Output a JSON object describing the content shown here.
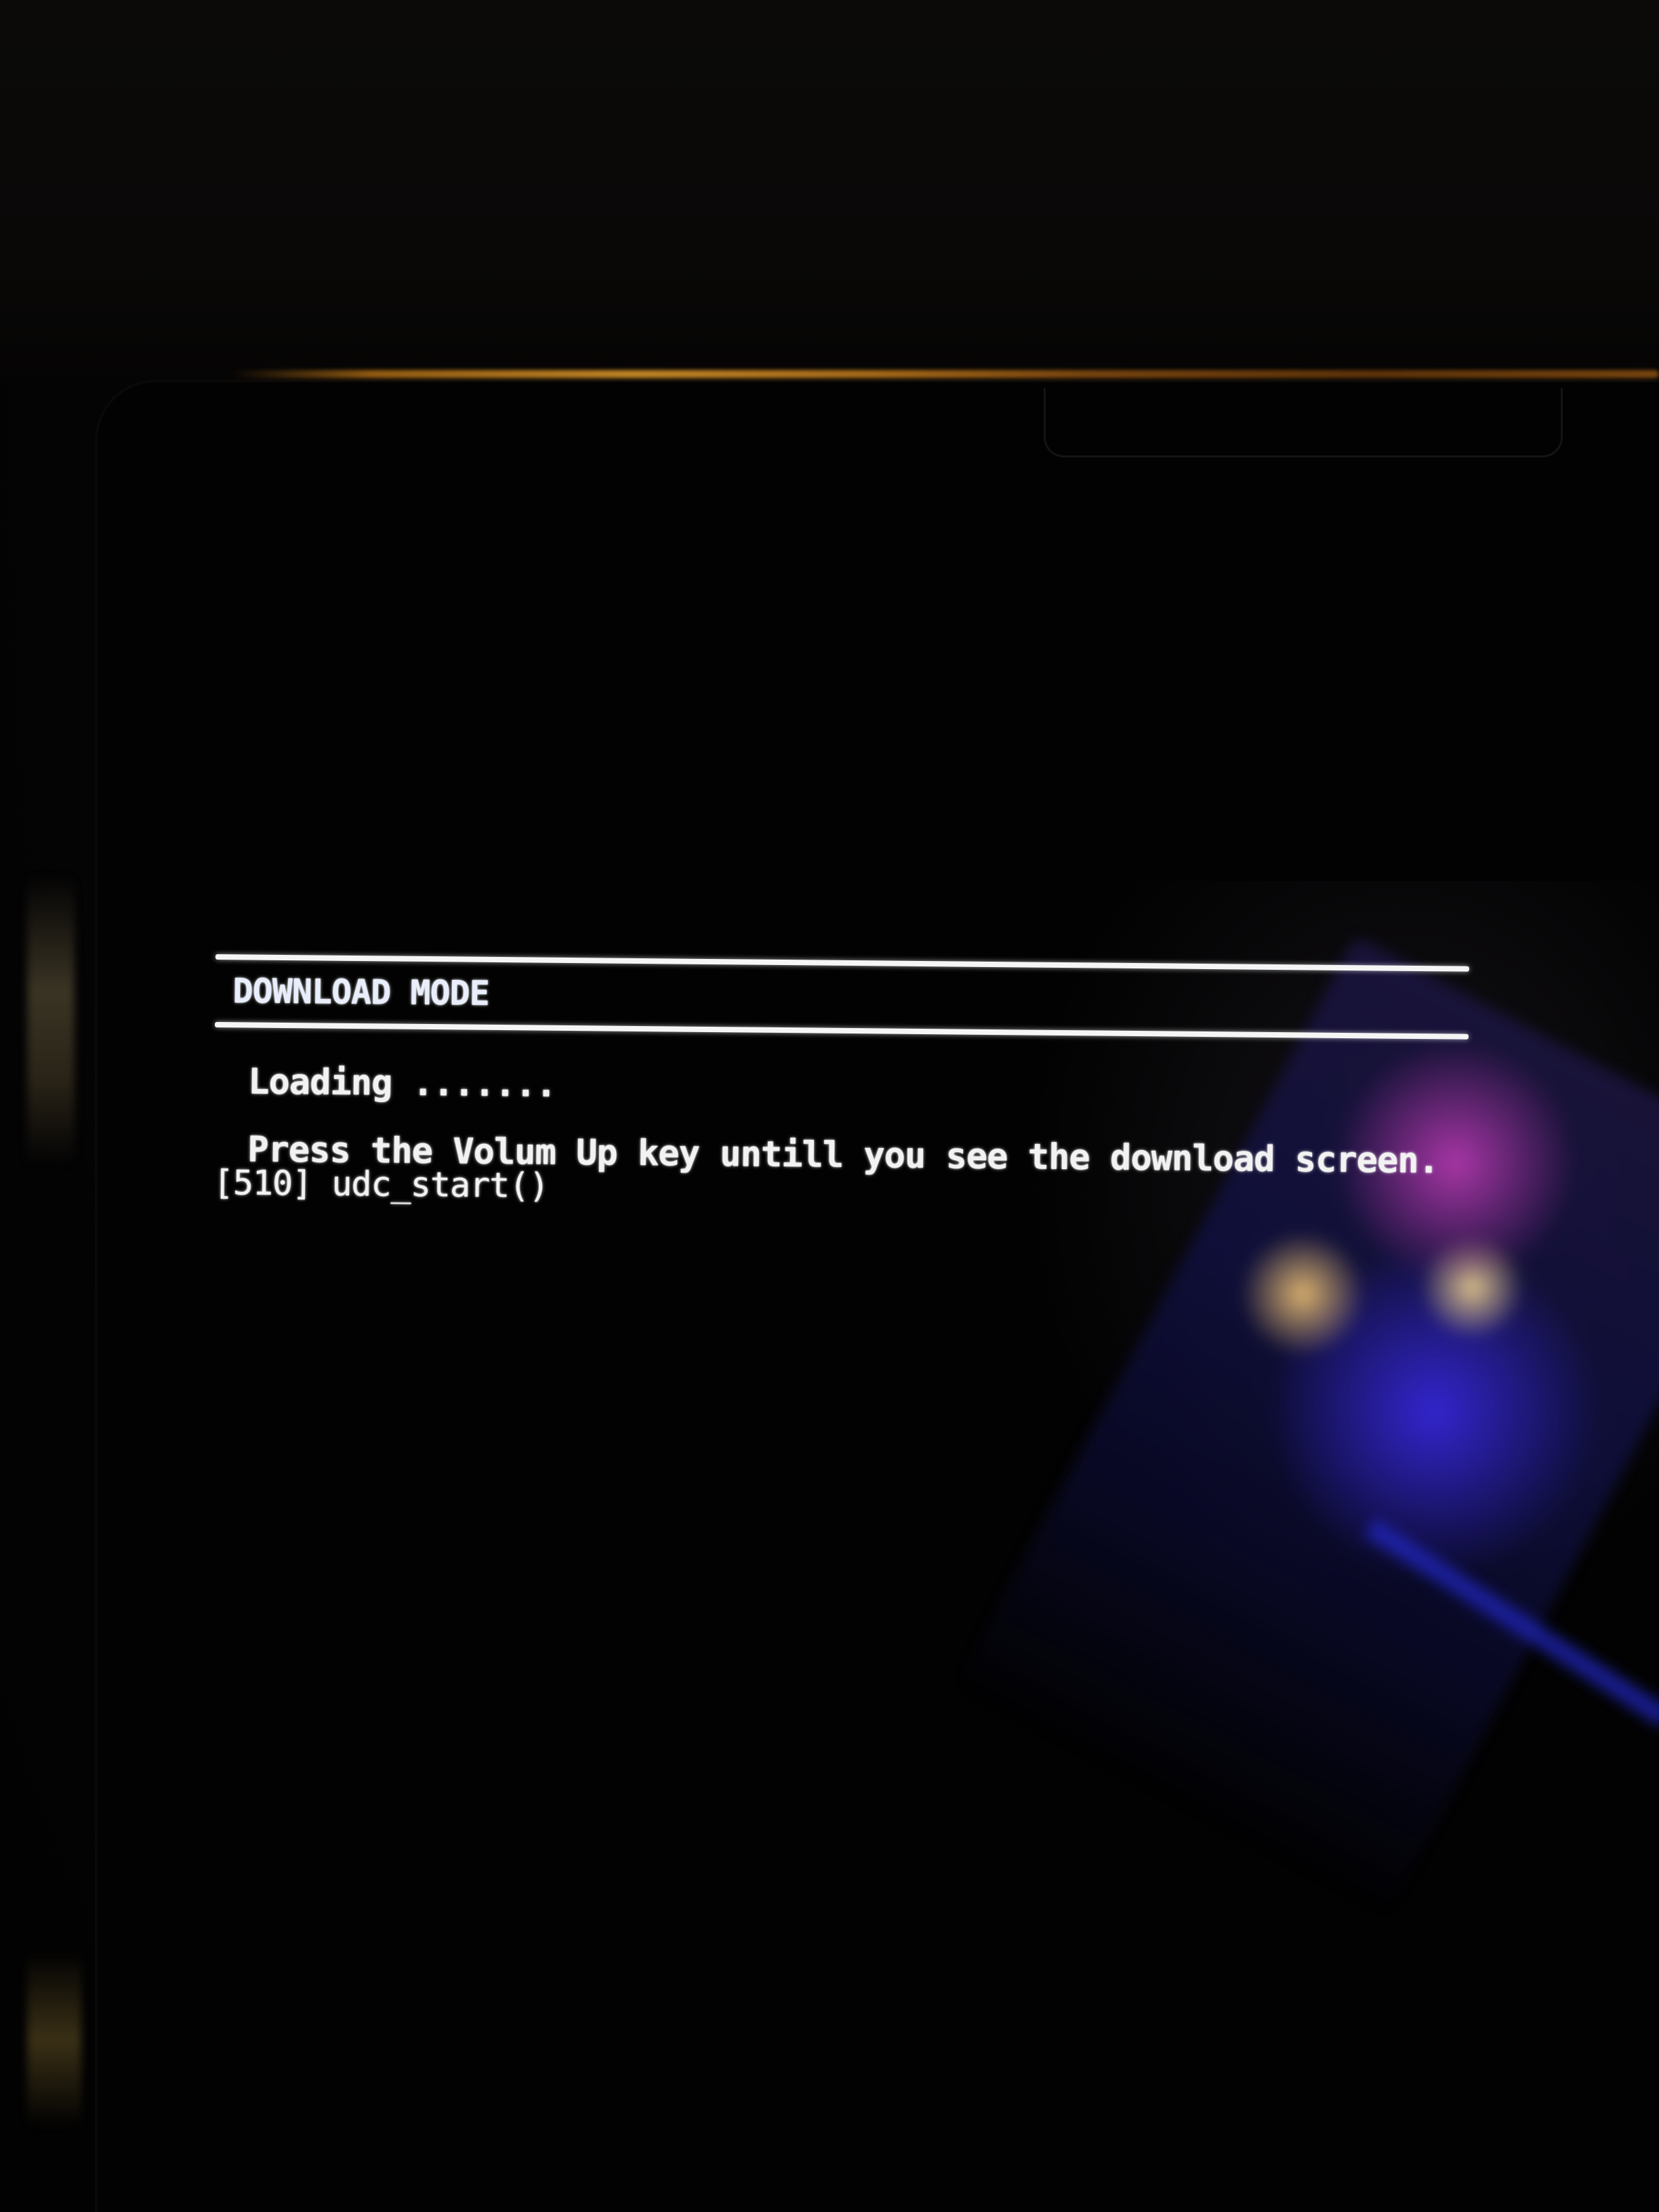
{
  "screen": {
    "mode_title": "DOWNLOAD MODE",
    "loading_text": "Loading .......",
    "instruction_text": "Press the Volum Up key untill you see the download screen.",
    "log_text": "[510] udc_start()"
  },
  "colors": {
    "background": "#020202",
    "text": "#f2f2f2",
    "edge_glow": "#e09a2a",
    "reflection_blue": "#3a2af0"
  }
}
